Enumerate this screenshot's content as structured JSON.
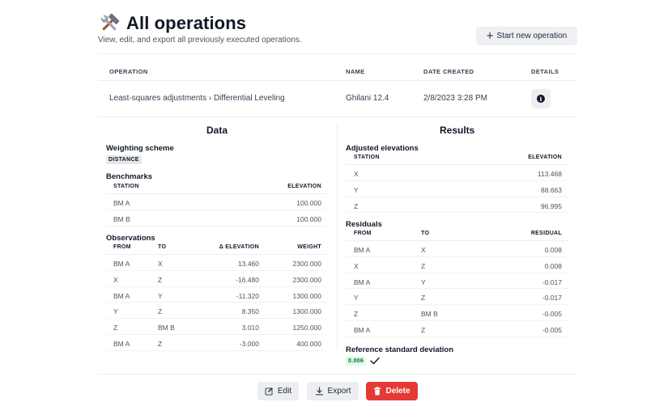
{
  "header": {
    "title": "All operations",
    "subtitle": "View, edit, and export all previously executed operations.",
    "title_icon": "hammer-wrench-icon",
    "start_button_label": "Start new operation"
  },
  "operations_table": {
    "columns": [
      "OPERATION",
      "NAME",
      "DATE CREATED",
      "DETAILS"
    ],
    "rows": [
      {
        "operation": "Least-squares adjustments › Differential Leveling",
        "name": "Ghilani 12.4",
        "date_created": "2/8/2023 3:28 PM",
        "details_icon": "info-icon"
      }
    ]
  },
  "data_panel": {
    "title": "Data",
    "weighting": {
      "title": "Weighting scheme",
      "value": "DISTANCE"
    },
    "benchmarks": {
      "title": "Benchmarks",
      "columns": [
        "STATION",
        "ELEVATION"
      ],
      "rows": [
        {
          "station": "BM A",
          "elevation": "100.000"
        },
        {
          "station": "BM B",
          "elevation": "100.000"
        }
      ]
    },
    "observations": {
      "title": "Observations",
      "columns": [
        "FROM",
        "TO",
        "Δ ELEVATION",
        "WEIGHT"
      ],
      "rows": [
        {
          "from": "BM A",
          "to": "X",
          "delta": "13.460",
          "weight": "2300.000"
        },
        {
          "from": "X",
          "to": "Z",
          "delta": "-16.480",
          "weight": "2300.000"
        },
        {
          "from": "BM A",
          "to": "Y",
          "delta": "-11.320",
          "weight": "1300.000"
        },
        {
          "from": "Y",
          "to": "Z",
          "delta": "8.350",
          "weight": "1300.000"
        },
        {
          "from": "Z",
          "to": "BM B",
          "delta": "3.010",
          "weight": "1250.000"
        },
        {
          "from": "BM A",
          "to": "Z",
          "delta": "-3.000",
          "weight": "400.000"
        }
      ]
    }
  },
  "results_panel": {
    "title": "Results",
    "adjusted": {
      "title": "Adjusted elevations",
      "columns": [
        "STATION",
        "ELEVATION"
      ],
      "rows": [
        {
          "station": "X",
          "elevation": "113.468"
        },
        {
          "station": "Y",
          "elevation": "88.663"
        },
        {
          "station": "Z",
          "elevation": "96.995"
        }
      ]
    },
    "residuals": {
      "title": "Residuals",
      "columns": [
        "FROM",
        "TO",
        "RESIDUAL"
      ],
      "rows": [
        {
          "from": "BM A",
          "to": "X",
          "residual": "0.008"
        },
        {
          "from": "X",
          "to": "Z",
          "residual": "0.008"
        },
        {
          "from": "BM A",
          "to": "Y",
          "residual": "-0.017"
        },
        {
          "from": "Y",
          "to": "Z",
          "residual": "-0.017"
        },
        {
          "from": "Z",
          "to": "BM B",
          "residual": "-0.005"
        },
        {
          "from": "BM A",
          "to": "Z",
          "residual": "-0.005"
        }
      ]
    },
    "reference_sd": {
      "title": "Reference standard deviation",
      "value": "0.006",
      "status_icon": "check-icon"
    }
  },
  "actions": {
    "edit_label": "Edit",
    "export_label": "Export",
    "delete_label": "Delete"
  },
  "colors": {
    "danger": "#e53935",
    "button_gray": "#eceef1",
    "success_badge_bg": "#dcfce7",
    "success_badge_text": "#166534"
  }
}
